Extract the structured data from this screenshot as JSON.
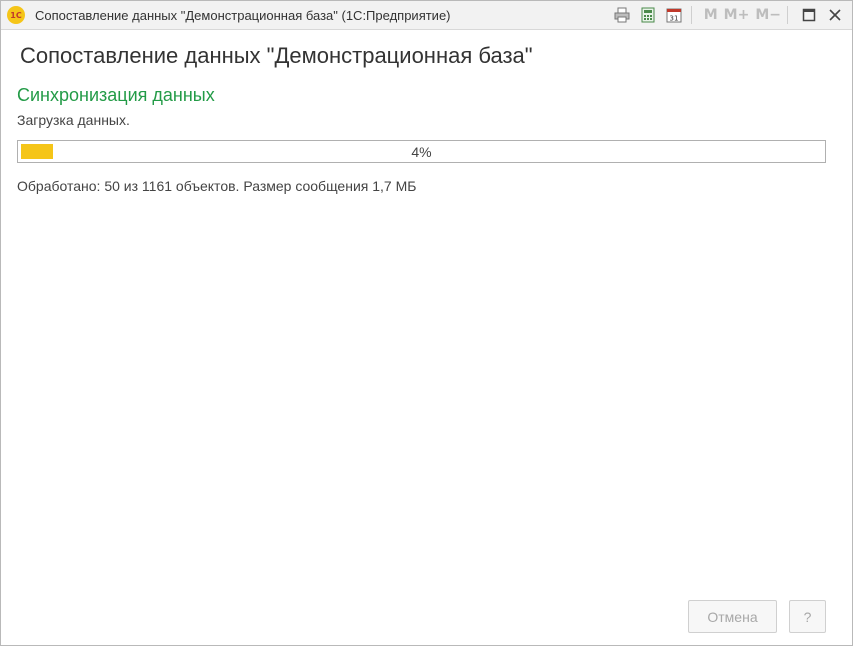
{
  "window": {
    "logo": "1С",
    "title": "Сопоставление данных \"Демонстрационная база\"  (1С:Предприятие)",
    "tools": {
      "print_icon": "printer-icon",
      "calc_icon": "calculator-icon",
      "calendar_icon": "calendar-icon",
      "calendar_day": "31",
      "m_label": "M",
      "m_plus_label": "M+",
      "m_minus_label": "M−",
      "maximize_icon": "maximize-icon",
      "close_icon": "close-icon"
    }
  },
  "form": {
    "title": "Сопоставление данных \"Демонстрационная база\"",
    "section": "Синхронизация данных",
    "stage": "Загрузка данных.",
    "progress": {
      "percent": 4,
      "label": "4%",
      "fill_color": "#f5c518"
    },
    "status": "Обработано: 50 из 1161 объектов. Размер сообщения 1,7 МБ"
  },
  "buttons": {
    "cancel": "Отмена",
    "help": "?"
  },
  "colors": {
    "section_title": "#239b47",
    "accent": "#f5c518"
  }
}
